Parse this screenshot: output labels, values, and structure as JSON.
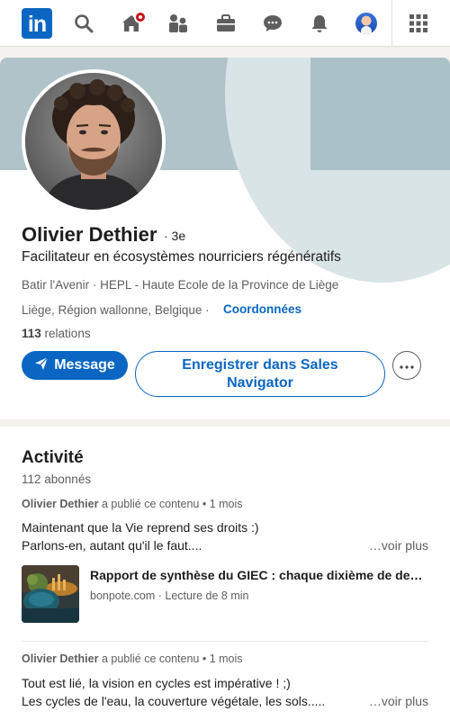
{
  "nav": {
    "logo_text": "in",
    "icons": [
      "search-icon",
      "home-icon",
      "network-icon",
      "jobs-icon",
      "messaging-icon",
      "notifications-icon",
      "me-avatar",
      "apps-grid-icon"
    ],
    "brand_color": "#0a66c2",
    "notification_color": "#cc1016"
  },
  "profile": {
    "name": "Olivier Dethier",
    "degree": "· 3e",
    "headline": "Facilitateur en écosystèmes nourriciers régénératifs",
    "education": "Batir l'Avenir · HEPL - Haute Ecole de la Province de Liège",
    "location": "Liège, Région wallonne, Belgique ·",
    "contact_link": "Coordonnées",
    "relations_count": "113",
    "relations_label": "relations",
    "message_button": "Message",
    "sales_button_line1": "Enregistrer dans Sales",
    "sales_button_line2": "Navigator",
    "more_icon": "ellipsis-icon"
  },
  "activity": {
    "title": "Activité",
    "followers": "112 abonnés",
    "posts": [
      {
        "author": "Olivier Dethier",
        "action": "a publié ce contenu",
        "time": "• 1 mois",
        "line1": "Maintenant que la Vie reprend ses droits :)",
        "line2": "Parlons-en, autant qu'il le faut....",
        "see_more": "…voir plus",
        "article_title": "Rapport de synthèse du GIEC : chaque dixième de de…",
        "article_source": "bonpote.com · Lecture de 8 min"
      },
      {
        "author": "Olivier Dethier",
        "action": "a publié ce contenu",
        "time": "• 1 mois",
        "line1": "Tout est lié, la vision en cycles est impérative ! ;)",
        "line2": "Les cycles de l'eau, la couverture végétale, les sols.....",
        "see_more": "…voir plus"
      }
    ]
  }
}
